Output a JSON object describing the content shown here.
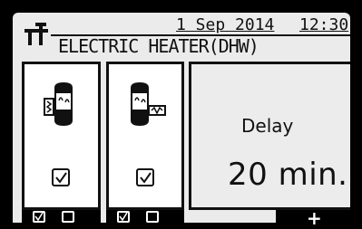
{
  "header": {
    "date": "1 Sep 2014",
    "time": "12:30",
    "title": "ELECTRIC HEATER(DHW)"
  },
  "panels": {
    "heater1": {
      "checked": true
    },
    "heater2": {
      "checked": true
    },
    "delay": {
      "label": "Delay",
      "value": "20 min."
    }
  },
  "footer": {
    "plus_label": "+"
  },
  "icons": [
    "settings-icon",
    "heater-tank-icon",
    "heater-tank-booster-icon",
    "checkbox-checked-icon",
    "checkbox-empty-icon"
  ]
}
